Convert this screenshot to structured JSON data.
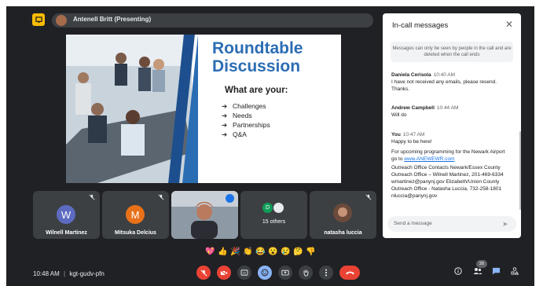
{
  "presenter": {
    "label": "Antenell Britt (Presenting)"
  },
  "slide": {
    "title": "Roundtable Discussion",
    "subtitle": "What are your:",
    "bullets": [
      "Challenges",
      "Needs",
      "Partnerships",
      "Q&A"
    ],
    "arrow": "➔"
  },
  "participants": [
    {
      "name": "Wilnell Martinez",
      "initial": "W",
      "color": "#5c6bc0"
    },
    {
      "name": "Mitsuka Delcius",
      "initial": "M",
      "color": "#e8711a"
    },
    {
      "name": "",
      "initial": "",
      "color": ""
    },
    {
      "name": "15 others",
      "initial": "D",
      "color": "#0f9d58"
    },
    {
      "name": "natasha luccia",
      "initial": "",
      "color": ""
    }
  ],
  "chat": {
    "title": "In-call messages",
    "notice": "Messages can only be seen by people in the call and are deleted when the call ends",
    "messages": [
      {
        "sender": "Daniela Cerisola",
        "time": "10:40 AM",
        "text": "I have not received any emails, please resend. Thanks."
      },
      {
        "sender": "Andrew Campbell",
        "time": "10:44 AM",
        "text": "Will do"
      },
      {
        "sender": "You",
        "time": "10:47 AM",
        "text": "Happy to be here!"
      },
      {
        "sender": "",
        "time": "",
        "text": "For upcoming programming for the Newark Airport go to",
        "link": "www.ANEWEWR.com"
      },
      {
        "sender": "",
        "time": "",
        "text": "Outreach Office Contacts Newark/Essex County Outreach Office – Wilnell Martinez, 201-469-6334 wmartinez@panynj.gov Elizabeth/Union County Outreach Office - Natasha Luccia, 732-258-1801 nluccia@panynj.gov"
      }
    ],
    "input_placeholder": "Send a message"
  },
  "reactions": [
    "💖",
    "👍",
    "🎉",
    "👏",
    "😂",
    "😮",
    "😢",
    "🤔",
    "👎"
  ],
  "footer": {
    "time": "10:48 AM",
    "separator": "|",
    "meeting_code": "kgt-gudv-pfn",
    "people_count": "20"
  },
  "colors": {
    "bg": "#202124",
    "tile": "#3c4043",
    "red": "#ea4335",
    "blue": "#8ab4f8",
    "accent_blue": "#2b6db3"
  }
}
